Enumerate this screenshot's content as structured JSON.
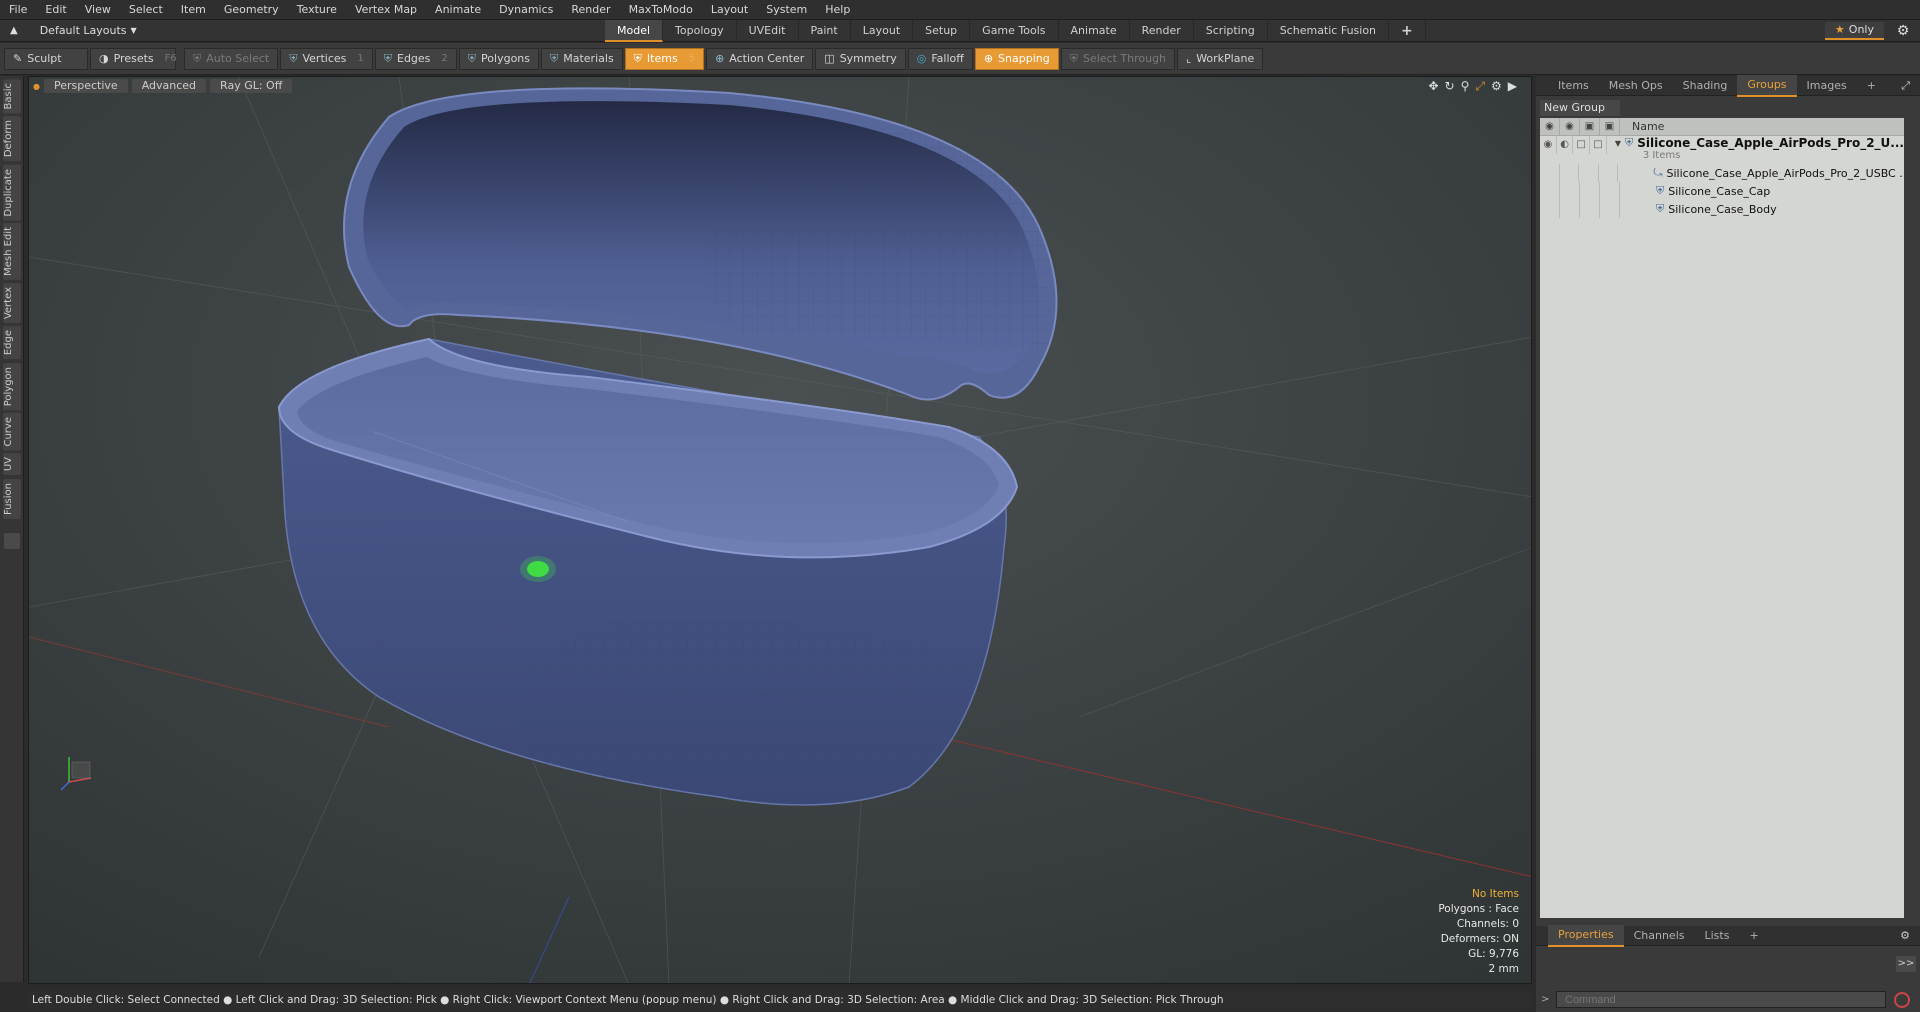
{
  "menu": [
    "File",
    "Edit",
    "View",
    "Select",
    "Item",
    "Geometry",
    "Texture",
    "Vertex Map",
    "Animate",
    "Dynamics",
    "Render",
    "MaxToModo",
    "Layout",
    "System",
    "Help"
  ],
  "layout_bar": {
    "layouts_label": "Default Layouts",
    "tabs": [
      "Model",
      "Topology",
      "UVEdit",
      "Paint",
      "Layout",
      "Setup",
      "Game Tools",
      "Animate",
      "Render",
      "Scripting",
      "Schematic Fusion"
    ],
    "active_tab": "Model",
    "plus": "+",
    "only_label": "Only"
  },
  "toolbar": {
    "sculpt": "Sculpt",
    "presets": "Presets",
    "presets_key": "F6",
    "auto_select": "Auto Select",
    "vertices": "Vertices",
    "vertices_count": "1",
    "edges": "Edges",
    "edges_count": "2",
    "polygons": "Polygons",
    "materials": "Materials",
    "items": "Items",
    "items_count": "5",
    "action_center": "Action Center",
    "symmetry": "Symmetry",
    "falloff": "Falloff",
    "snapping": "Snapping",
    "select_through": "Select Through",
    "workplane": "WorkPlane"
  },
  "left_tabs": [
    "Basic",
    "Deform",
    "Duplicate",
    "Mesh Edit",
    "Vertex",
    "Edge",
    "Polygon",
    "Curve",
    "UV",
    "Fusion"
  ],
  "viewport": {
    "view": "Perspective",
    "shading": "Advanced",
    "raygl": "Ray GL: Off",
    "info": {
      "no_items": "No Items",
      "polygons": "Polygons : Face",
      "channels": "Channels: 0",
      "deformers": "Deformers: ON",
      "gl": "GL: 9,776",
      "scale": "2 mm"
    }
  },
  "status": "Left Double Click: Select Connected ● Left Click and Drag: 3D Selection: Pick ● Right Click: Viewport Context Menu (popup menu) ● Right Click and Drag: 3D Selection: Area ● Middle Click and Drag: 3D Selection: Pick Through",
  "right_panel": {
    "tabs": [
      "Items",
      "Mesh Ops",
      "Shading",
      "Groups",
      "Images"
    ],
    "active_tab": "Groups",
    "plus": "+",
    "new_group": "New Group",
    "name_header": "Name",
    "group_name": "Silicone_Case_Apple_AirPods_Pro_2_U...",
    "group_sub": "3 Items",
    "items": [
      "Silicone_Case_Apple_AirPods_Pro_2_USBC ...",
      "Silicone_Case_Cap",
      "Silicone_Case_Body"
    ]
  },
  "bottom_panel": {
    "tabs": [
      "Properties",
      "Channels",
      "Lists"
    ],
    "active_tab": "Properties",
    "plus": "+",
    "command_placeholder": "Command",
    "expand": ">>"
  },
  "colors": {
    "accent": "#e0902a",
    "mesh": "#4a5a8c",
    "viewport_bg": "#3a3f40"
  }
}
